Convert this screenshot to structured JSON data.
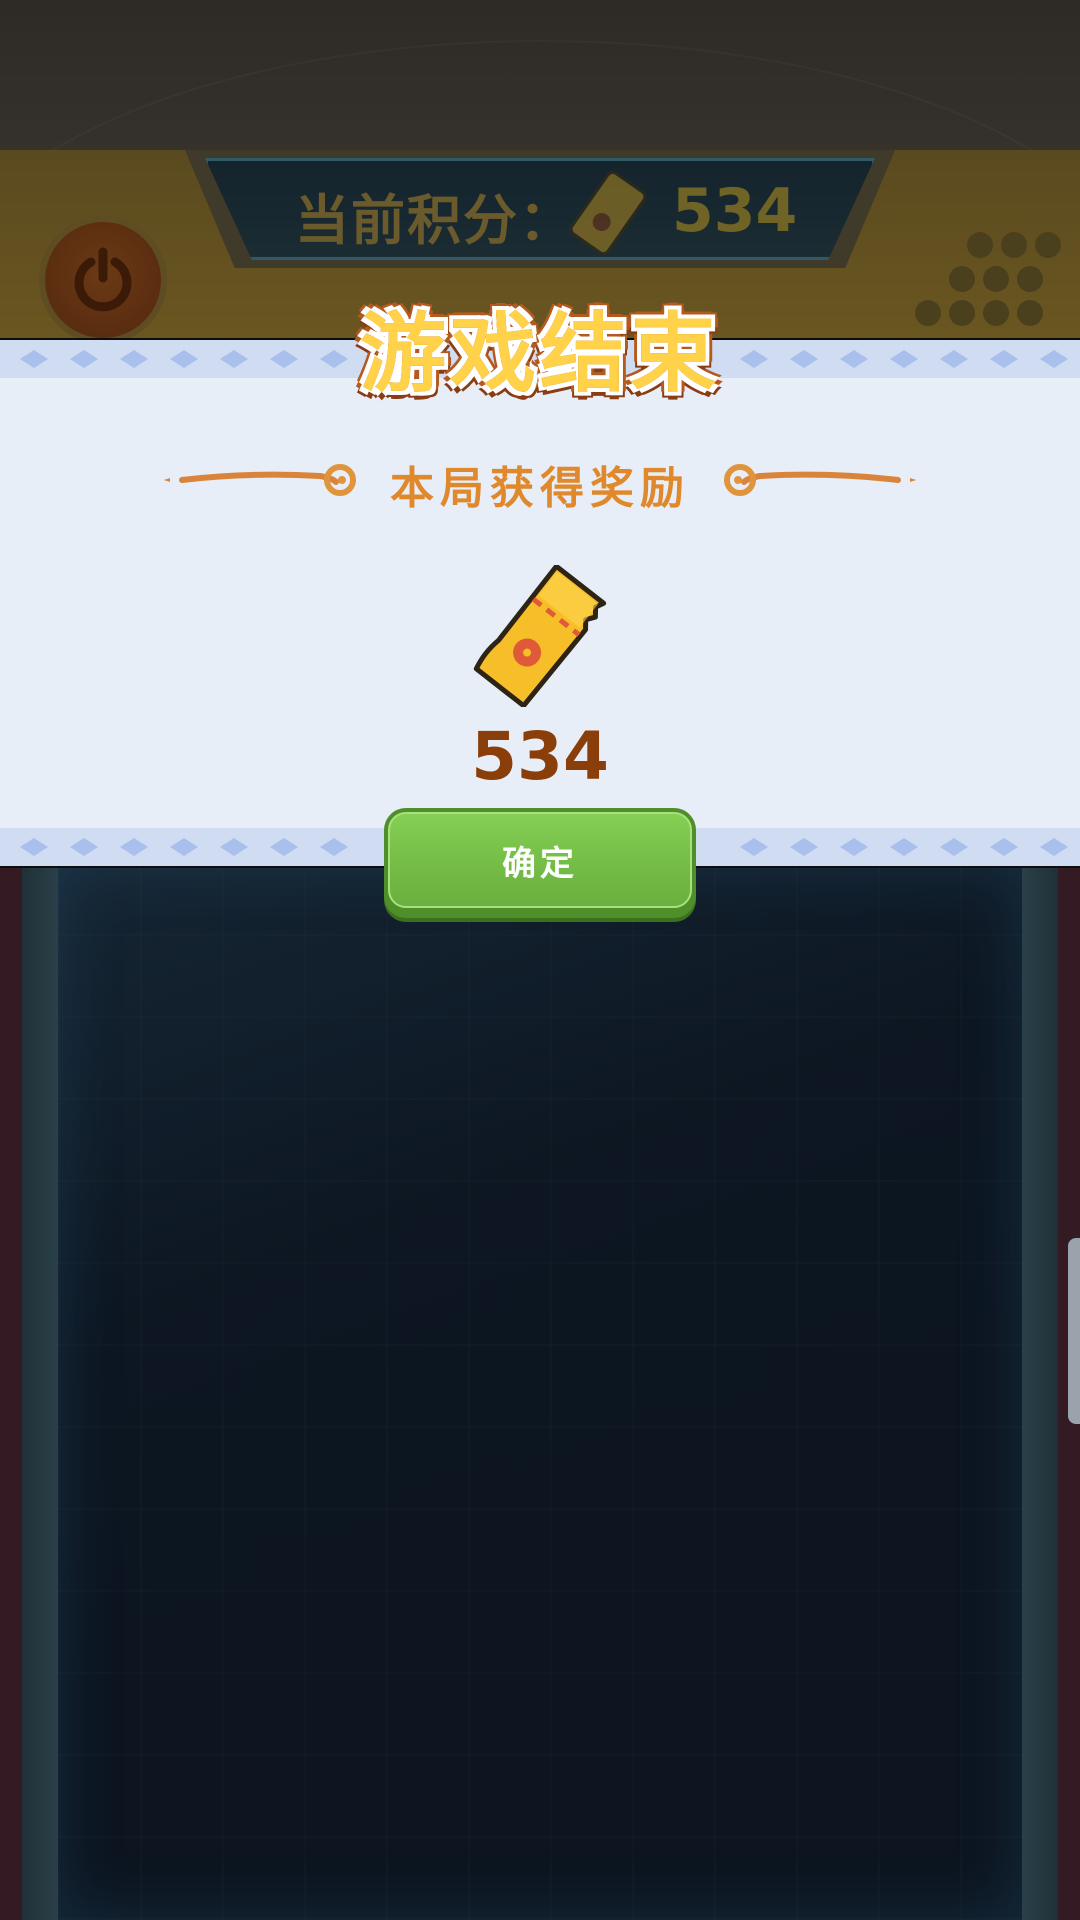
{
  "hud": {
    "score_label": "当前积分：",
    "score_value": "534",
    "power_icon": "power-icon",
    "ticket_icon": "ticket-icon"
  },
  "result_dialog": {
    "title": "游戏结束",
    "subtitle": "本局获得奖励",
    "reward_icon": "ticket-icon",
    "reward_value": "534",
    "confirm_label": "确定"
  },
  "colors": {
    "title_fill": "#ffd24a",
    "subtitle": "#e0882c",
    "reward_value": "#8a3f0a",
    "confirm_button": "#74bd46",
    "panel_bg": "#e8eef7",
    "board_bg": "#0c1520"
  }
}
